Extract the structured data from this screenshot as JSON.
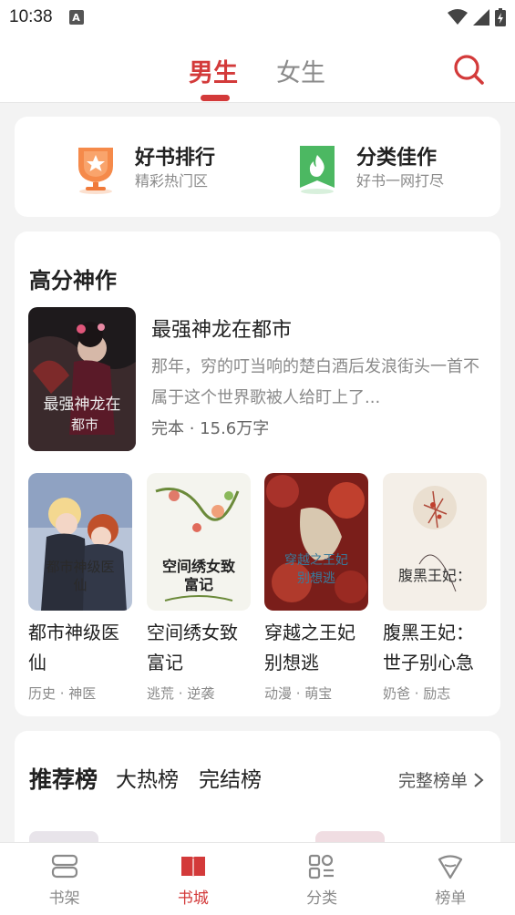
{
  "status_bar": {
    "time": "10:38",
    "badge": "A"
  },
  "header": {
    "tabs": [
      {
        "label": "男生",
        "active": true
      },
      {
        "label": "女生",
        "active": false
      }
    ]
  },
  "features": [
    {
      "title": "好书排行",
      "subtitle": "精彩热门区",
      "icon": "trophy-icon",
      "color": "#f07a3a"
    },
    {
      "title": "分类佳作",
      "subtitle": "好书一网打尽",
      "icon": "bookmark-flame-icon",
      "color": "#4cb862"
    }
  ],
  "high_score": {
    "title": "高分神作",
    "hero": {
      "title": "最强神龙在都市",
      "description": "那年，穷的叮当响的楚白酒后发浪街头一首不属于这个世界歌被人给盯上了...",
      "meta": "完本 · 15.6万字",
      "cover_text": "最强神龙在都市"
    },
    "books": [
      {
        "title": "都市神级医仙",
        "tags": "历史 · 神医",
        "cover_text": "都市神级医仙"
      },
      {
        "title": "空间绣女致富记",
        "tags": "逃荒 · 逆袭",
        "cover_text": "空间绣女致富记"
      },
      {
        "title": "穿越之王妃别想逃",
        "tags": "动漫 · 萌宝",
        "cover_text": "穿越之王妃别想逃"
      },
      {
        "title": "腹黑王妃：世子别心急",
        "tags": "奶爸 · 励志",
        "cover_text": "腹黑王妃："
      }
    ]
  },
  "ranking": {
    "tabs": [
      "推荐榜",
      "大热榜",
      "完结榜"
    ],
    "more_label": "完整榜单"
  },
  "bottom_nav": [
    {
      "label": "书架",
      "icon": "bookshelf-icon",
      "active": false
    },
    {
      "label": "书城",
      "icon": "bookstore-icon",
      "active": true
    },
    {
      "label": "分类",
      "icon": "category-icon",
      "active": false
    },
    {
      "label": "榜单",
      "icon": "ranking-icon",
      "active": false
    }
  ],
  "colors": {
    "accent": "#d33a3a",
    "muted": "#8a8a8a",
    "background": "#f3f3f3"
  }
}
